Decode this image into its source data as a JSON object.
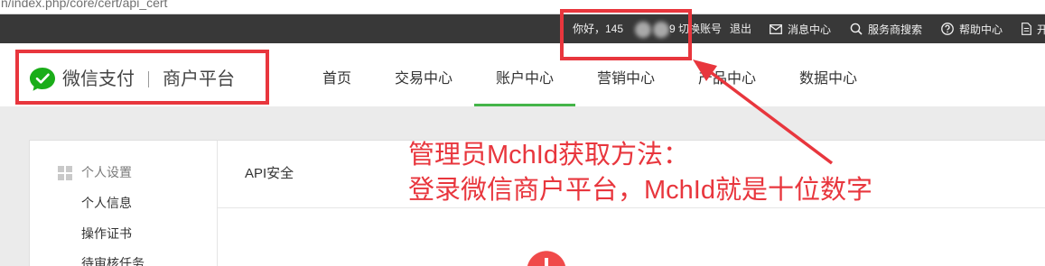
{
  "browser": {
    "url_fragment": "n/index.php/core/cert/api_cert"
  },
  "topbar": {
    "greeting": "你好，145",
    "greeting_tail": "9",
    "switch_account": "切换账号",
    "logout": "退出",
    "items": [
      {
        "icon": "envelope-icon",
        "label": "消息中心"
      },
      {
        "icon": "search-icon",
        "label": "服务商搜索"
      },
      {
        "icon": "help-circle-icon",
        "label": "帮助中心"
      },
      {
        "icon": "document-icon",
        "label": "开"
      }
    ]
  },
  "brand": {
    "icon": "wechat-pay-logo-icon",
    "name": "微信支付",
    "platform": "商户平台"
  },
  "nav": {
    "items": [
      "首页",
      "交易中心",
      "账户中心",
      "营销中心",
      "产品中心",
      "数据中心"
    ],
    "active_index": 2
  },
  "sidebar": {
    "group": {
      "icon": "grid-icon",
      "label": "个人设置"
    },
    "items": [
      "个人信息",
      "操作证书",
      "待审核任务"
    ]
  },
  "content": {
    "title": "API安全",
    "fab_icon": "plus-icon"
  },
  "annotation": {
    "lines": [
      "管理员MchId获取方法：",
      "登录微信商户平台，MchId就是十位数字"
    ]
  },
  "colors": {
    "topbar_bg": "#383838",
    "page_bg": "#ebebeb",
    "accent_green": "#44b549",
    "logo_green": "#1aad19",
    "annotation_red": "#e8363d"
  }
}
